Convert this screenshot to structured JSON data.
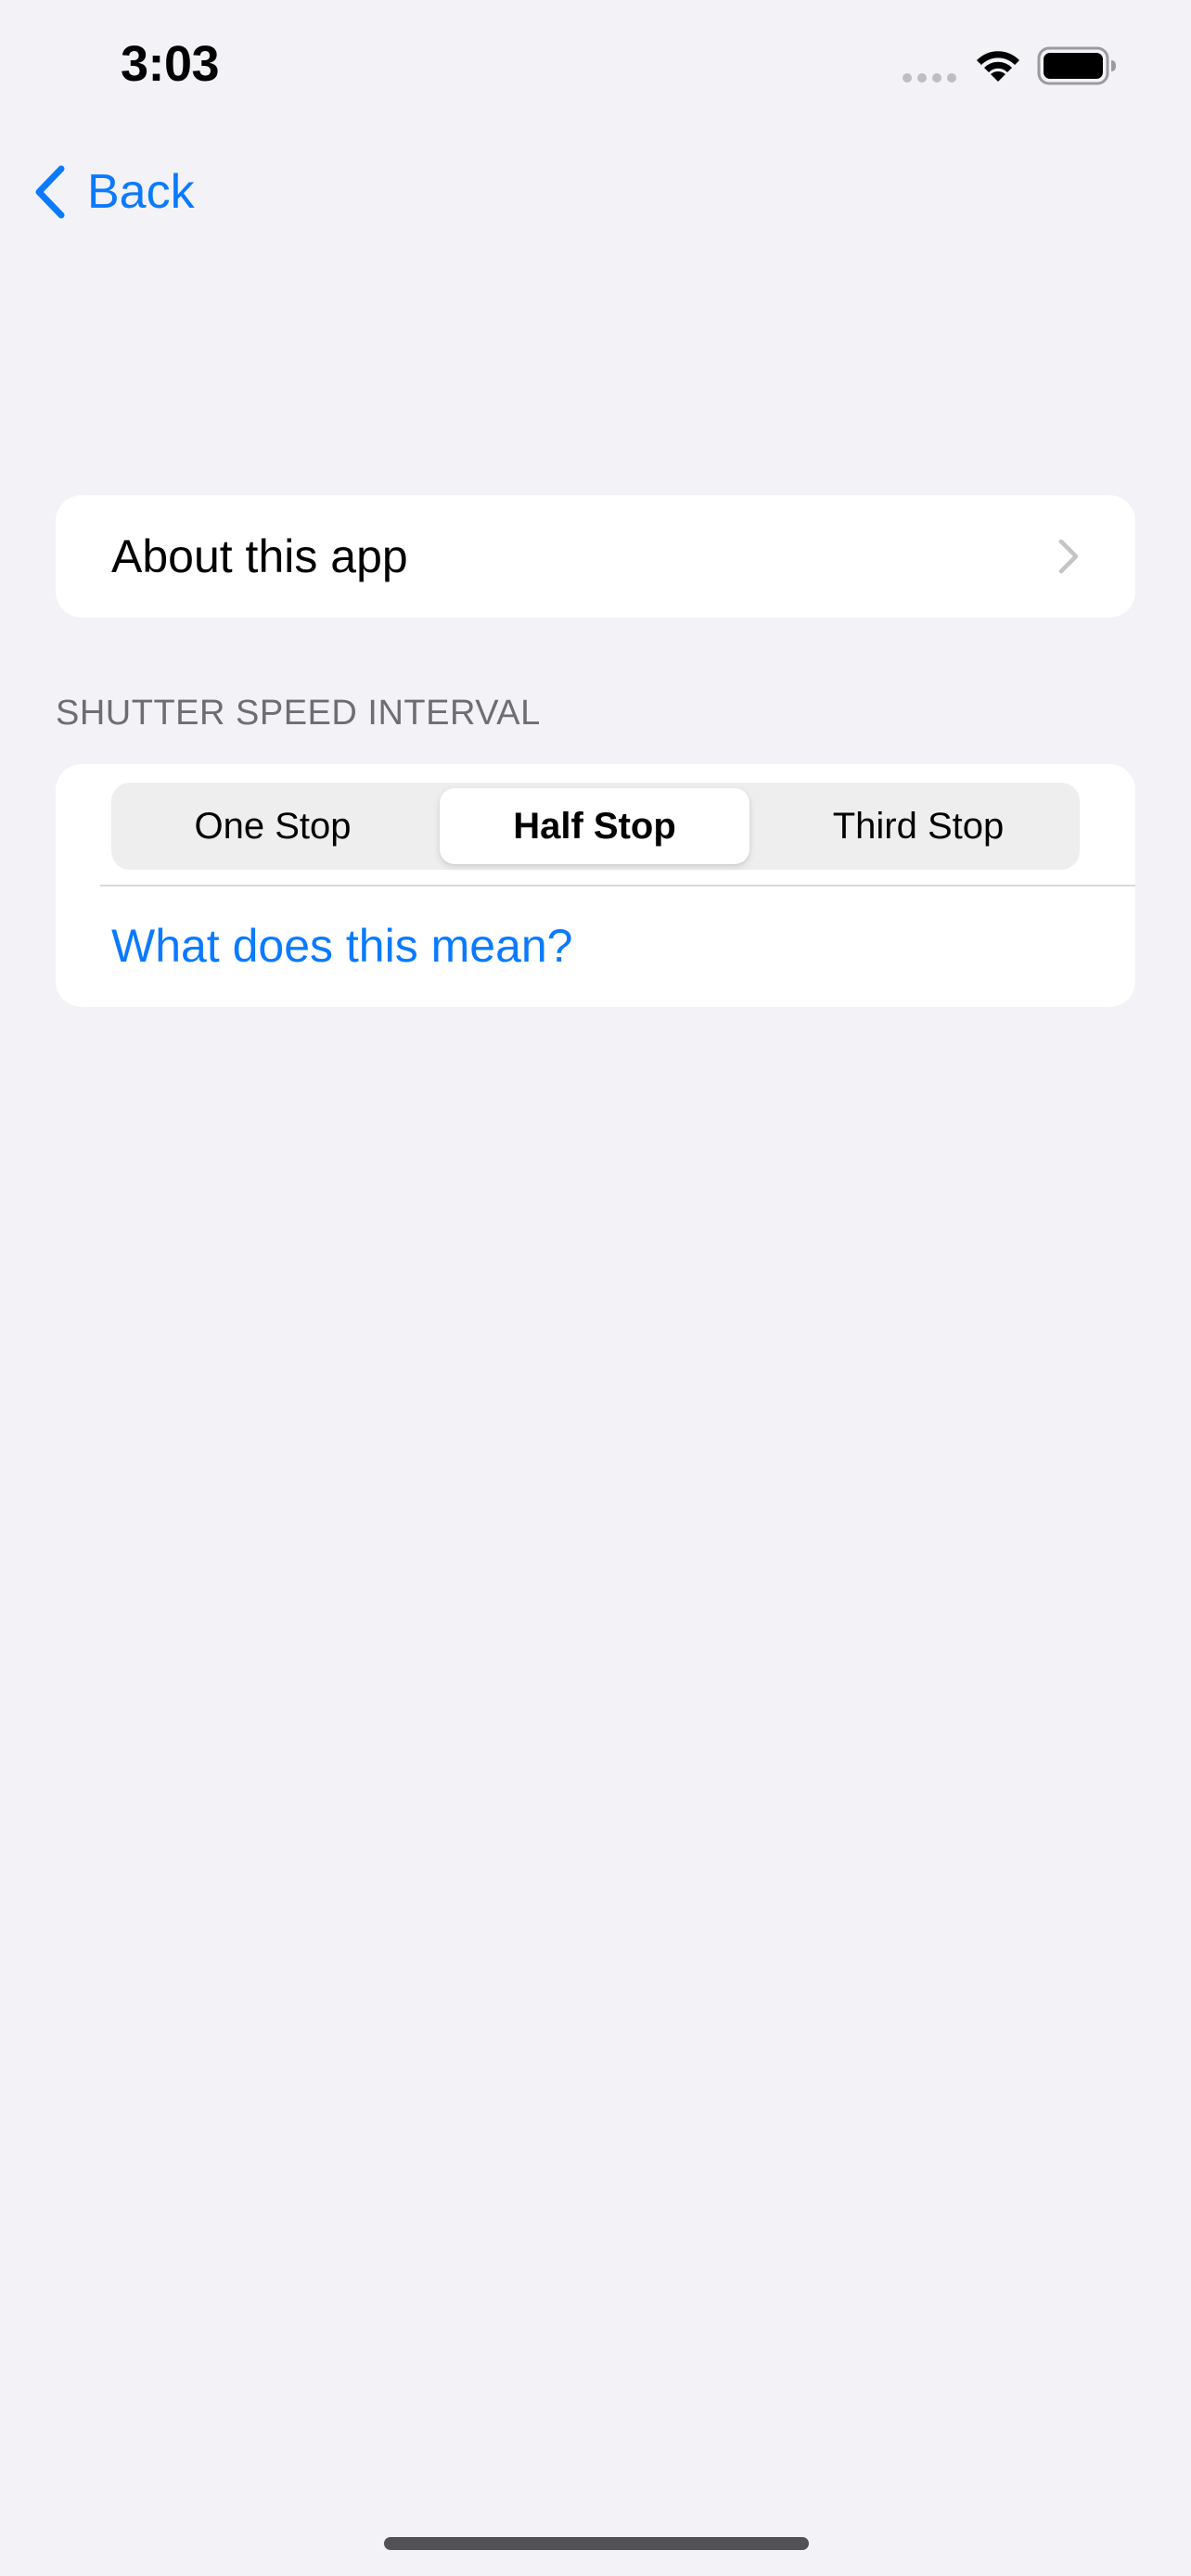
{
  "status_bar": {
    "time": "3:03",
    "icons": [
      "signal-dots-icon",
      "wifi-icon",
      "battery-icon"
    ]
  },
  "nav": {
    "back_label": "Back",
    "back_icon": "chevron-left-icon"
  },
  "about_row": {
    "label": "About this app",
    "icon": "chevron-right-icon"
  },
  "shutter_section": {
    "header": "SHUTTER SPEED INTERVAL",
    "segments": [
      {
        "label": "One Stop",
        "selected": false
      },
      {
        "label": "Half Stop",
        "selected": true
      },
      {
        "label": "Third Stop",
        "selected": false
      }
    ],
    "help_link": "What does this mean?"
  },
  "colors": {
    "accent": "#0a7aff",
    "background": "#f2f2f7",
    "card": "#ffffff",
    "section_header": "#6d6d72"
  }
}
